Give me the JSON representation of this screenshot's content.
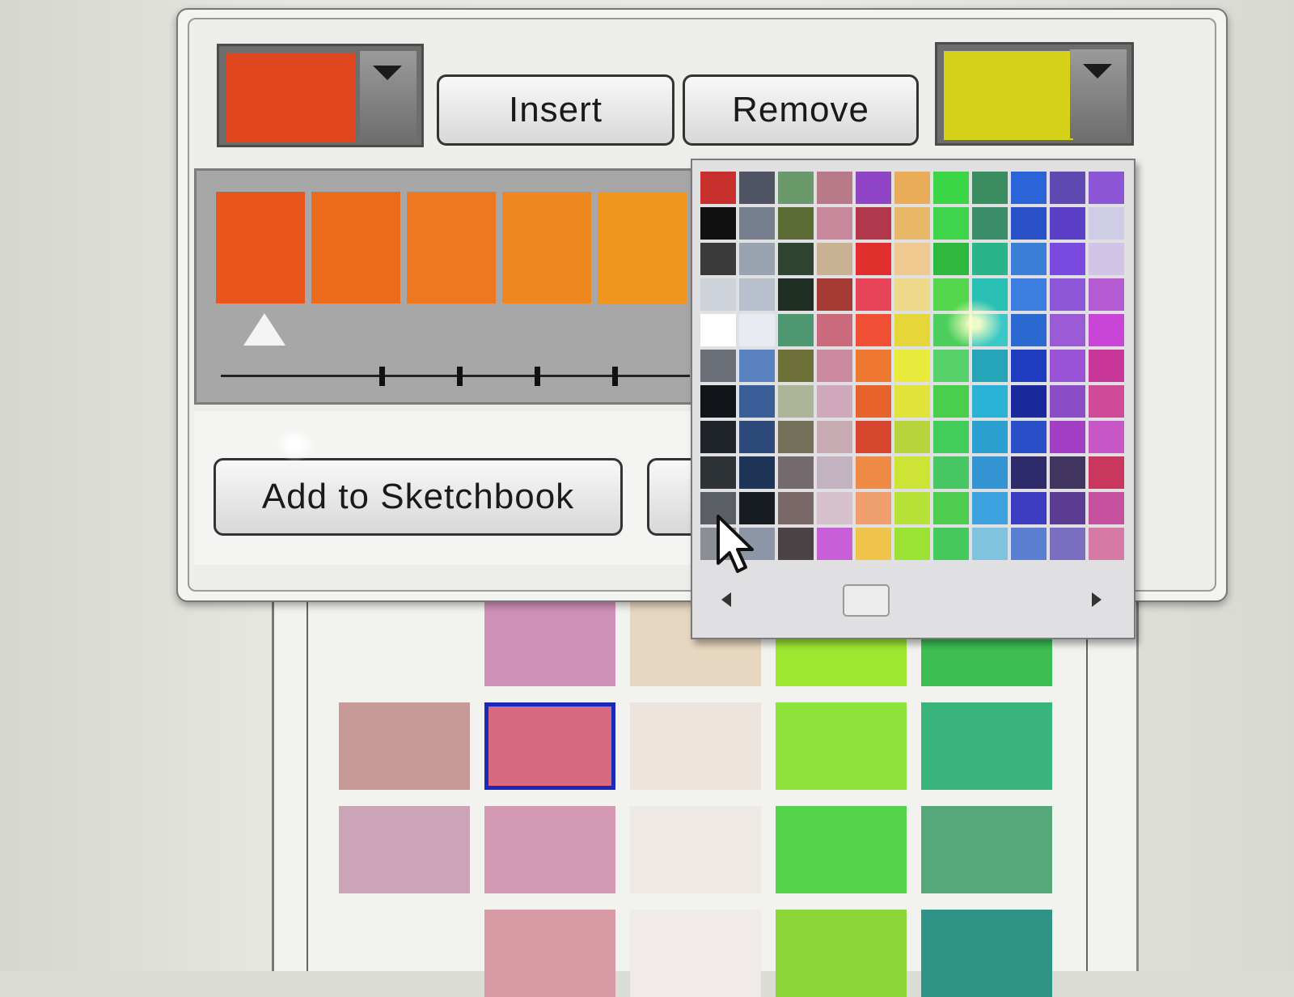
{
  "toolbar": {
    "insert_label": "Insert",
    "remove_label": "Remove",
    "start_color": "#e0471e",
    "end_color": "#d6d21c"
  },
  "gradient": {
    "stops": [
      "#e8561c",
      "#ec6a1c",
      "#ee781f",
      "#ef8720",
      "#f0961f"
    ],
    "active_stop": 1
  },
  "actions": {
    "add_to_sketchbook_label": "Add to Sketchbook"
  },
  "picker": {
    "columns": [
      [
        "#c8302e",
        "#111111",
        "#3a3a3a",
        "#cfd3db",
        "#ffffff",
        "#6b7078",
        "#111418",
        "#20252b",
        "#2e3337",
        "#5a5f66",
        "#8a8f96"
      ],
      [
        "#4e5463",
        "#76808f",
        "#9aa3b0",
        "#b7c0cc",
        "#e8ecf2",
        "#5a82c0",
        "#3a5f98",
        "#2d4a7a",
        "#1f3558",
        "#171b22",
        "#8d96a6"
      ],
      [
        "#6b9a6a",
        "#5a6b34",
        "#2f4430",
        "#1f2f23",
        "#4f9770",
        "#6d7038",
        "#adb598",
        "#75705a",
        "#746a6e",
        "#7a6868",
        "#4a4244"
      ],
      [
        "#b77a86",
        "#c6889a",
        "#c9b294",
        "#a53a32",
        "#cb6a7c",
        "#cc8aa0",
        "#d0a9bc",
        "#c8aab3",
        "#c3b2c0",
        "#d6c0cc",
        "#c85ed8"
      ],
      [
        "#8f45c6",
        "#b0374c",
        "#e02f2c",
        "#e8455a",
        "#ef5036",
        "#ef7831",
        "#e8622c",
        "#d6462c",
        "#ee8a46",
        "#ef9f6e",
        "#f0c44a"
      ],
      [
        "#e9ad59",
        "#e9b868",
        "#f0c990",
        "#eed88a",
        "#e6d63a",
        "#e8ea3c",
        "#e2e33a",
        "#b8d43c",
        "#cde336",
        "#b6e238",
        "#9ae234"
      ],
      [
        "#3bd645",
        "#3fd44a",
        "#2eb83e",
        "#54d74c",
        "#4dcf5e",
        "#57d26a",
        "#49cf4a",
        "#42cc5a",
        "#46c762",
        "#4fcd50",
        "#46c95c"
      ],
      [
        "#3b8c5e",
        "#3c8e6a",
        "#2ab48a",
        "#2ac1b4",
        "#3ac8c6",
        "#26a5b8",
        "#2ab3d6",
        "#2a9fd0",
        "#3594d4",
        "#3ca2e0",
        "#7fc3de"
      ],
      [
        "#2a64d8",
        "#2a50c8",
        "#3b7ed8",
        "#3b7ee0",
        "#2c69d0",
        "#1e3cc0",
        "#1a2a9c",
        "#2a4ec8",
        "#2d2b6c",
        "#3c3cc0",
        "#5a7fd0"
      ],
      [
        "#5e4ab2",
        "#5a3fc6",
        "#7a4ae0",
        "#8d57d8",
        "#9b5ad6",
        "#9a52d6",
        "#8b4dc6",
        "#a13ec4",
        "#41345e",
        "#5b3c92",
        "#7a6ec0"
      ],
      [
        "#8c55d6",
        "#cfcde6",
        "#d2c4e6",
        "#b45ad2",
        "#c845d8",
        "#c8369a",
        "#d04a9a",
        "#c858c8",
        "#c9365e",
        "#c4509e",
        "#d87aa6"
      ]
    ]
  },
  "background_swatches": [
    [
      null,
      "#cf91b8",
      "#e7d7c0",
      "#9ee832",
      "#3dbe53"
    ],
    [
      "#c79a98",
      "#d86a80",
      "#ebe3dc",
      "#8ee43a",
      "#39b47a"
    ],
    [
      "#cba4b8",
      "#d49ab4",
      "#efe9e6",
      "#53d24a",
      "#55a877"
    ],
    [
      null,
      "#d89aa4",
      "#f0ebe8",
      "#8cd63a",
      "#2f9486"
    ]
  ],
  "background_selected": [
    1,
    1
  ]
}
